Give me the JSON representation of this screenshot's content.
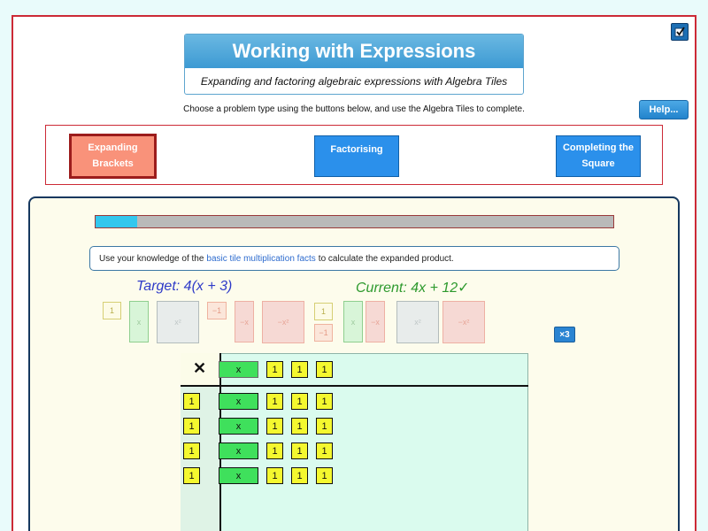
{
  "header": {
    "title": "Working with Expressions",
    "subtitle": "Expanding and factoring algebraic expressions with Algebra Tiles",
    "instructions": "Choose a problem type using the buttons below, and use the Algebra Tiles to complete.",
    "help_label": "Help..."
  },
  "problem_types": {
    "expanding": "Expanding Brackets",
    "factorising": "Factorising",
    "completing": "Completing the Square",
    "active": "expanding"
  },
  "progress": {
    "fraction": 0.08
  },
  "hint": {
    "before": "Use your knowledge of the",
    "link": "basic tile multiplication facts",
    "after": "to calculate the expanded product."
  },
  "target": "Target: 4(x + 3)",
  "current": "Current: 4x + 12",
  "current_check": "✓",
  "palette": {
    "one": "1",
    "x": "x",
    "sq": "x²",
    "neg1": "−1",
    "negx": "−x",
    "negsq": "−x²"
  },
  "multiply_label": "×3",
  "grid": {
    "times_symbol": "✕",
    "top_x": "x",
    "top_ones": [
      "1",
      "1",
      "1"
    ],
    "rows": [
      {
        "left": "1",
        "x": "x",
        "ones": [
          "1",
          "1",
          "1"
        ]
      },
      {
        "left": "1",
        "x": "x",
        "ones": [
          "1",
          "1",
          "1"
        ]
      },
      {
        "left": "1",
        "x": "x",
        "ones": [
          "1",
          "1",
          "1"
        ]
      },
      {
        "left": "1",
        "x": "x",
        "ones": [
          "1",
          "1",
          "1"
        ]
      }
    ]
  },
  "colors": {
    "accent": "#2b90eb",
    "active_type": "#f9927a",
    "target": "#2f3bc8",
    "current": "#2e9a2e",
    "tile_one": "#f4f82f",
    "tile_x": "#3fe05c"
  }
}
